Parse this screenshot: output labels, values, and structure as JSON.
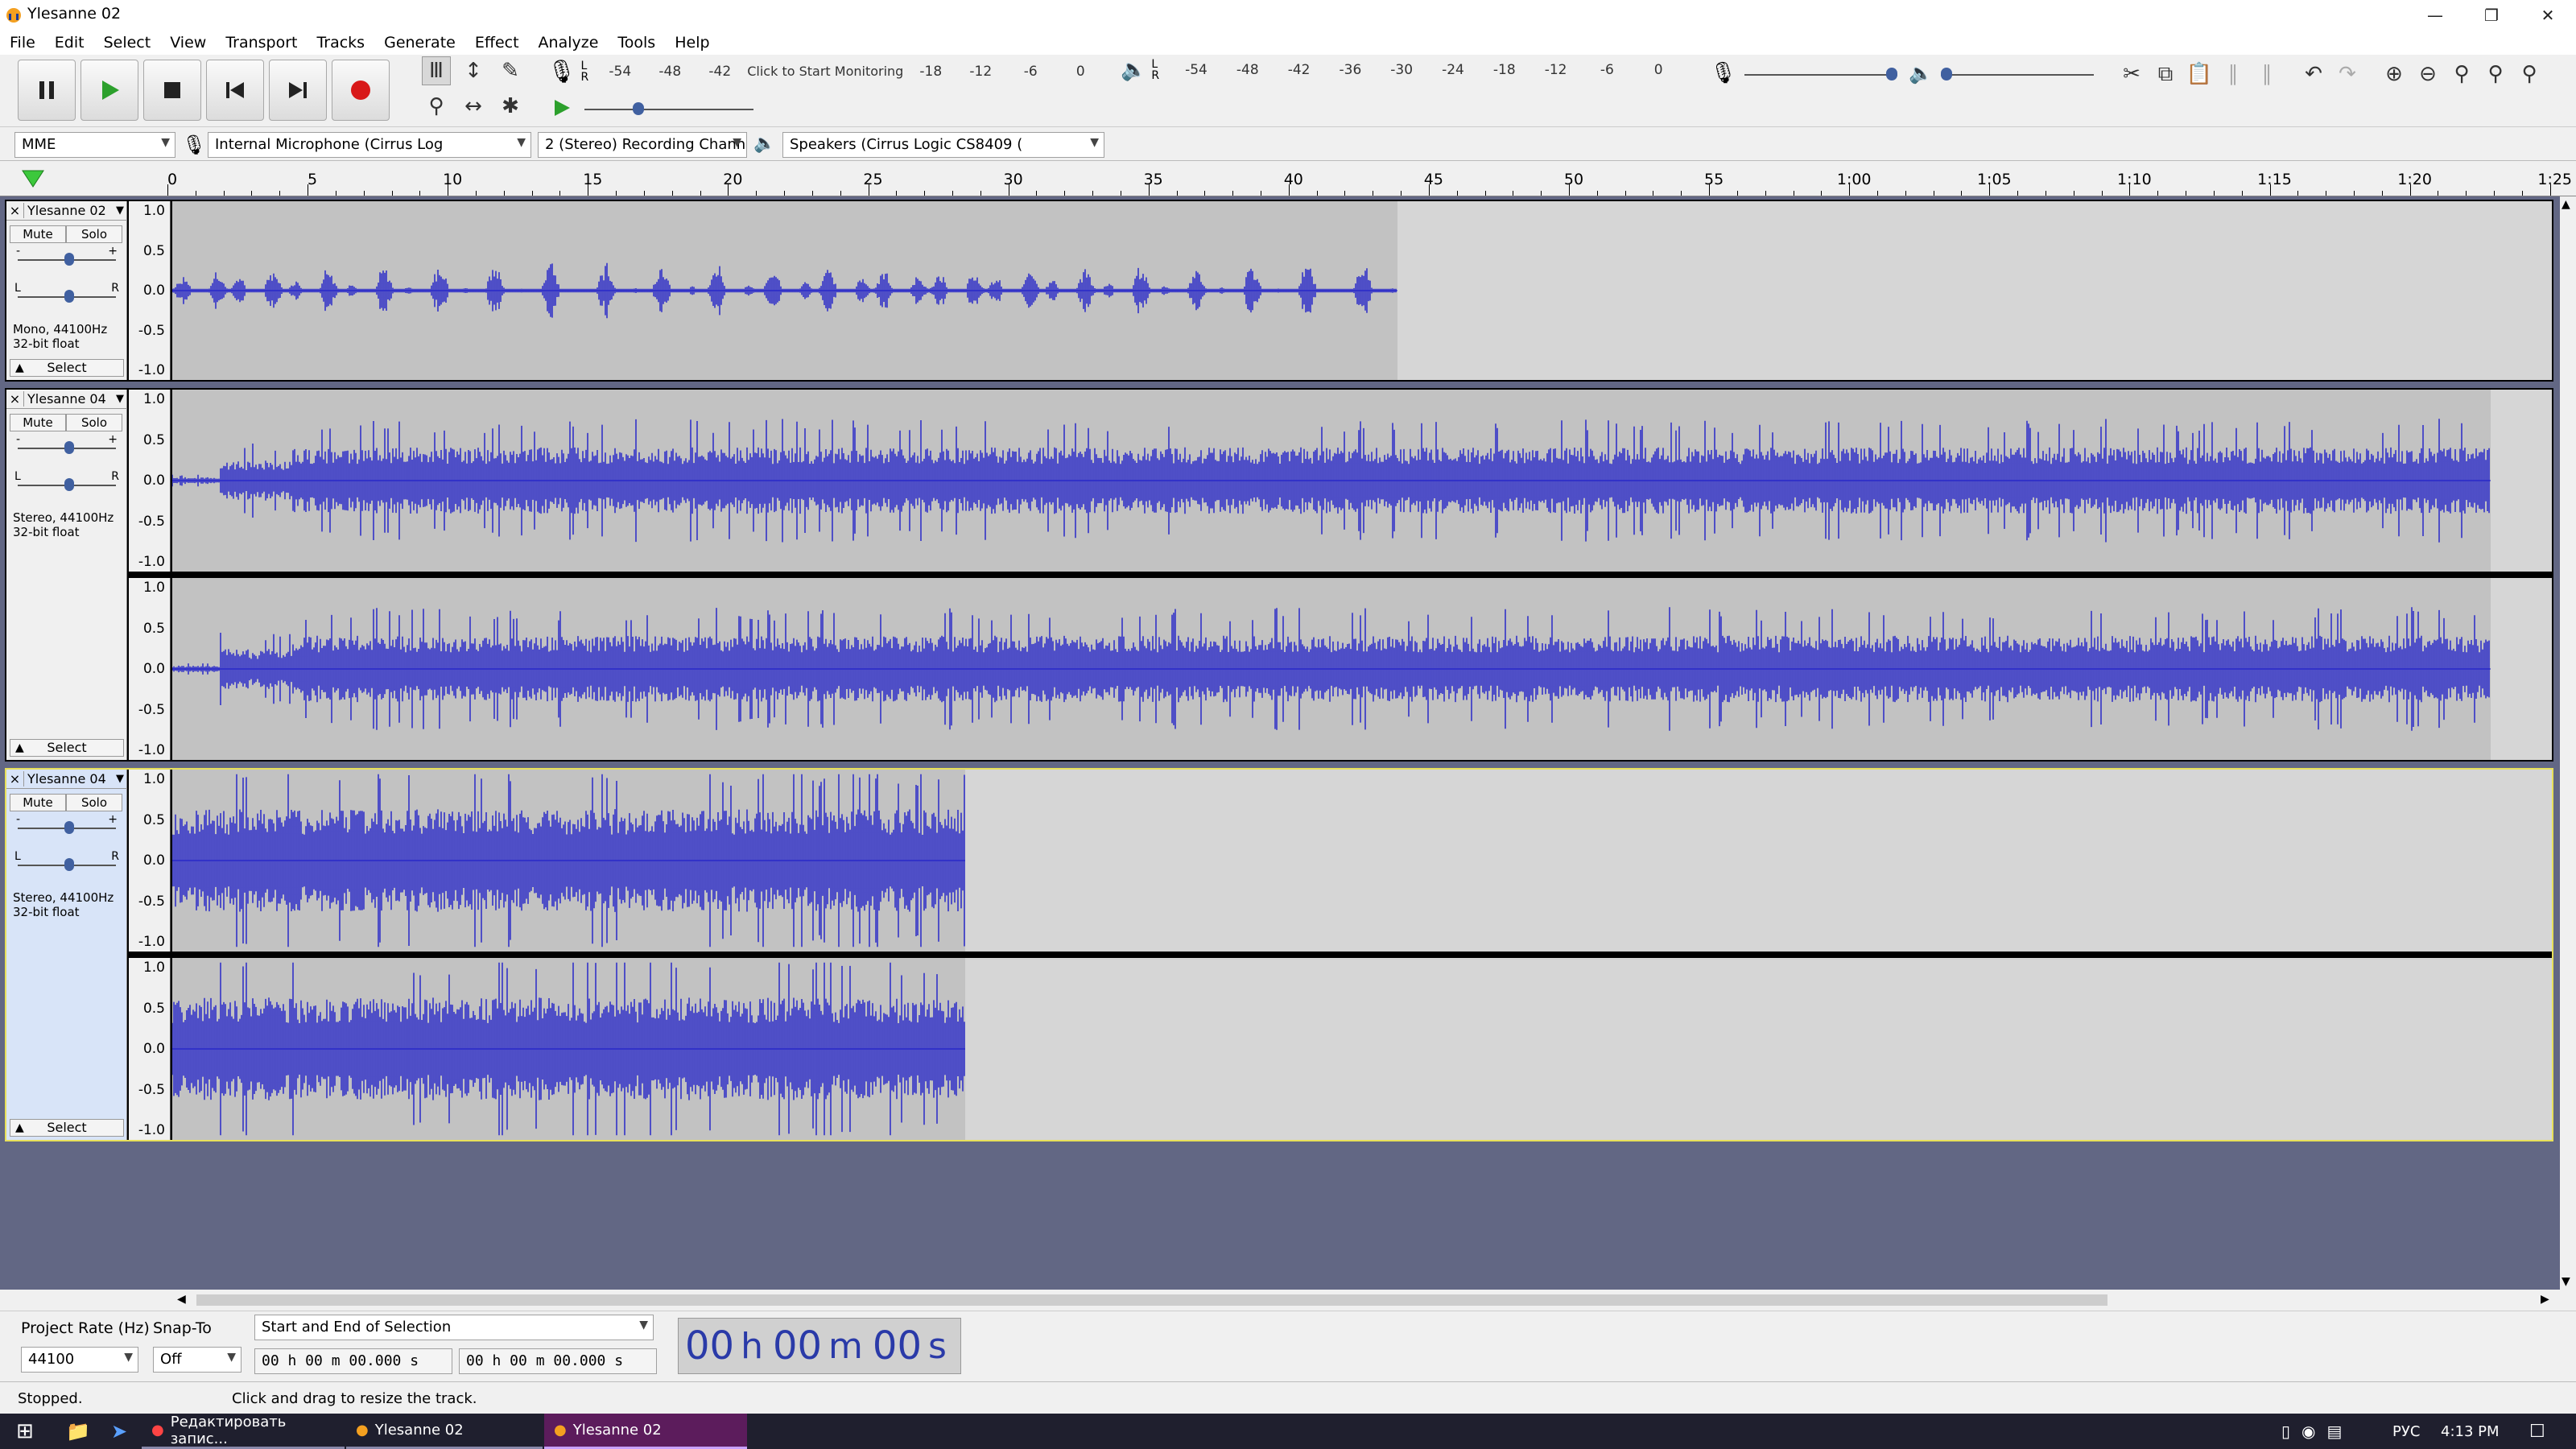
{
  "window": {
    "title": "Ylesanne 02"
  },
  "menu": [
    "File",
    "Edit",
    "Select",
    "View",
    "Transport",
    "Tracks",
    "Generate",
    "Effect",
    "Analyze",
    "Tools",
    "Help"
  ],
  "meters": {
    "record_prompt": "Click to Start Monitoring",
    "record_ticks": [
      "-54",
      "-48",
      "-42",
      "-18",
      "-12",
      "-6",
      "0"
    ],
    "play_ticks": [
      "-54",
      "-48",
      "-42",
      "-36",
      "-30",
      "-24",
      "-18",
      "-12",
      "-6",
      "0"
    ]
  },
  "device": {
    "host": "MME",
    "input": "Internal Microphone (Cirrus Log",
    "channels": "2 (Stereo) Recording Chann",
    "output": "Speakers (Cirrus Logic CS8409 ("
  },
  "ruler": {
    "ticks": [
      "0",
      "5",
      "10",
      "15",
      "20",
      "25",
      "30",
      "35",
      "40",
      "45",
      "50",
      "55",
      "1:00",
      "1:05",
      "1:10",
      "1:15",
      "1:20",
      "1:25"
    ]
  },
  "colors": {
    "waveform": "#3232c8",
    "clip_bg": "#c2c2c2",
    "empty_bg": "#d6d6d6",
    "tracks_bg": "#626784",
    "selected_border": "#e8e05a"
  },
  "tracks": [
    {
      "name": "Ylesanne 02",
      "close": "×",
      "mute": "Mute",
      "solo": "Solo",
      "gain_minus": "-",
      "gain_plus": "+",
      "pan_left": "L",
      "pan_right": "R",
      "info1": "Mono, 44100Hz",
      "info2": "32-bit float",
      "select": "Select",
      "selected": false,
      "channels": 1,
      "clip_end": 43.7,
      "amp": 0.2
    },
    {
      "name": "Ylesanne 04",
      "close": "×",
      "mute": "Mute",
      "solo": "Solo",
      "gain_minus": "-",
      "gain_plus": "+",
      "pan_left": "L",
      "pan_right": "R",
      "info1": "Stereo, 44100Hz",
      "info2": "32-bit float",
      "select": "Select",
      "selected": false,
      "channels": 2,
      "clip_end": 82.7,
      "amp": 0.55
    },
    {
      "name": "Ylesanne 04",
      "close": "×",
      "mute": "Mute",
      "solo": "Solo",
      "gain_minus": "-",
      "gain_plus": "+",
      "pan_left": "L",
      "pan_right": "R",
      "info1": "Stereo, 44100Hz",
      "info2": "32-bit float",
      "select": "Select",
      "selected": true,
      "channels": 2,
      "clip_end": 28.3,
      "amp": 0.85
    }
  ],
  "vruler_labels": [
    "1.0",
    "0.5",
    "0.0",
    "-0.5",
    "-1.0"
  ],
  "selection": {
    "rate_label": "Project Rate (Hz)",
    "rate_value": "44100",
    "snap_label": "Snap-To",
    "snap_value": "Off",
    "mode": "Start and End of Selection",
    "start": "00 h 00 m 00.000 s",
    "end": "00 h 00 m 00.000 s",
    "time_h": "00",
    "time_h_unit": "h",
    "time_m": "00",
    "time_m_unit": "m",
    "time_s": "00",
    "time_s_unit": "s"
  },
  "status": {
    "state": "Stopped.",
    "hint": "Click and drag to resize the track."
  },
  "taskbar": {
    "item1": "Редактировать запис...",
    "item2": "Ylesanne 02",
    "item3": "Ylesanne 02",
    "lang": "РУС",
    "clock": "4:13 PM"
  }
}
